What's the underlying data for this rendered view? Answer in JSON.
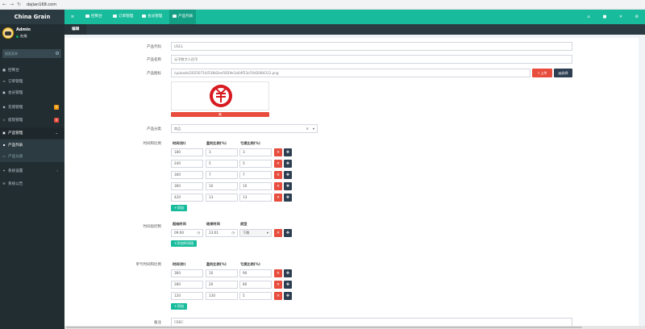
{
  "browser": {
    "url": "dajian168.com"
  },
  "app": {
    "logo": "China Grain"
  },
  "topnav": {
    "items": [
      {
        "label": "控制台"
      },
      {
        "label": "订单管理"
      },
      {
        "label": "会员管理"
      },
      {
        "label": "产品列表"
      }
    ]
  },
  "user": {
    "name": "Admin",
    "status": "在线"
  },
  "search": {
    "placeholder": "搜索菜单"
  },
  "sidebar": {
    "items": [
      {
        "label": "控制台"
      },
      {
        "label": "订单管理"
      },
      {
        "label": "会员管理"
      },
      {
        "label": "充值管理",
        "badge": "5"
      },
      {
        "label": "提现管理",
        "badge": "6"
      },
      {
        "label": "产品管理"
      },
      {
        "label": "产品列表"
      },
      {
        "label": "产品分类"
      },
      {
        "label": "系统设置"
      },
      {
        "label": "系统公告"
      }
    ]
  },
  "tab": {
    "label": "编辑"
  },
  "form": {
    "code": {
      "label": "产品代码",
      "value": "USCL"
    },
    "name": {
      "label": "产品名称",
      "value": "元币数字人民币"
    },
    "icon": {
      "label": "产品图标",
      "value": "/uploads/20250714/538d2ee5929e1a04f53cf1fd2084312.png",
      "upload": "上传",
      "choose": "选择",
      "delete": "删"
    },
    "category": {
      "label": "产品分类",
      "value": "商品"
    },
    "times": {
      "label": "时间和比例",
      "headers": [
        "时间(秒)",
        "盈利比例(%)",
        "亏损比例(%)"
      ],
      "rows": [
        {
          "time": "180",
          "win": "3",
          "loss": "3"
        },
        {
          "time": "240",
          "win": "5",
          "loss": "5"
        },
        {
          "time": "300",
          "win": "7",
          "loss": "7"
        },
        {
          "time": "360",
          "win": "10",
          "loss": "10"
        },
        {
          "time": "420",
          "win": "13",
          "loss": "13"
        }
      ],
      "add": "添加"
    },
    "control": {
      "label": "时间段控制",
      "headers": [
        "起始时间",
        "结束时间",
        "类型"
      ],
      "rows": [
        {
          "start": "09:00",
          "end": "23:01",
          "type": "下跌"
        }
      ],
      "add": "添加时间段"
    },
    "options": {
      "label": "单亏时间和比例",
      "headers": [
        "时间(秒)",
        "盈利比例(%)",
        "亏损比例(%)"
      ],
      "rows": [
        {
          "time": "360",
          "win": "10",
          "loss": "90"
        },
        {
          "time": "280",
          "win": "20",
          "loss": "80"
        },
        {
          "time": "120",
          "win": "130",
          "loss": "5"
        }
      ],
      "add": "添加"
    },
    "remark": {
      "label": "备注",
      "value": "CBBC"
    }
  }
}
